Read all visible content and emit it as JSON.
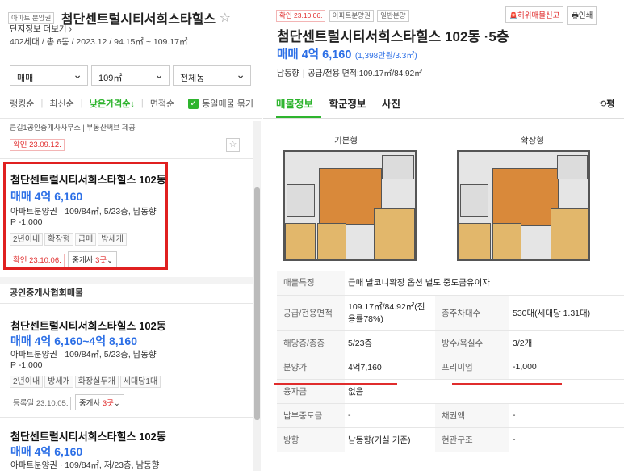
{
  "left_panel": {
    "header": {
      "type_tag": "아파트 분양권",
      "complex_name": "첨단센트럴시티서희스타힐스",
      "star": "☆",
      "info_link": "단지정보 더보기",
      "info_link_arrow": "›",
      "summary": "402세대 / 총 6동 / 2023.12 / 94.15㎡ ~ 109.17㎡"
    },
    "filters": [
      {
        "value": "매매",
        "chevron": "⌄"
      },
      {
        "value": "109㎡",
        "chevron": "⌄"
      },
      {
        "value": "전체동",
        "chevron": "⌄"
      }
    ],
    "sort": {
      "options": [
        "랭킹순",
        "최신순",
        "낮은가격순↓",
        "면적순"
      ],
      "separator": "|",
      "active": "낮은가격순↓",
      "checkbox_mark": "✓",
      "checkbox_label": "동일매물 묶기"
    },
    "partial_top": {
      "agency_text": "큰길1공인중개사사무소 | 부동산써브 제공",
      "confirm_tag": "확인 23.09.12."
    },
    "listings": [
      {
        "title": "첨단센트럴시티서희스타힐스 102동",
        "price": "매매 4억 6,160",
        "info": "아파트분양권 · 109/84㎡, 5/23층, 남동향",
        "premium": "P -1,000",
        "tags": [
          "2년이내",
          "확장형",
          "급매",
          "방세개"
        ],
        "confirm": "확인 23.10.06.",
        "agents_prefix": "중개사",
        "agents_count": "3곳",
        "agents_chevron": "⌄"
      },
      {
        "title": "첨단센트럴시티서희스타힐스 102동",
        "price": "매매 4억 6,160~4억 8,160",
        "info": "아파트분양권 · 109/84㎡, 5/23층, 남동향",
        "premium": "P -1,000",
        "tags": [
          "2년이내",
          "방세개",
          "화장실두개",
          "세대당1대"
        ],
        "confirm": "등록일 23.10.05.",
        "agents_prefix": "중개사",
        "agents_count": "3곳",
        "agents_chevron": "⌄"
      },
      {
        "title": "첨단센트럴시티서희스타힐스 102동",
        "price": "매매 4억 6,160",
        "info": "아파트분양권 · 109/84㎡, 저/23층, 남동향"
      }
    ],
    "section_header": "공인중개사협회매물"
  },
  "right_panel": {
    "tags": [
      "확인 23.10.06.",
      "아파트분양권",
      "일반분양"
    ],
    "buttons": {
      "report_icon": "🚨",
      "report": "허위매물신고",
      "print_icon": "🖶",
      "print": "인쇄"
    },
    "title": "첨단센트럴시티서희스타힐스 102동 ·5층",
    "price": "매매 4억 6,160",
    "price_per": "(1,398만원/3.3㎡)",
    "direction": "남동향",
    "area_label": "공급/전용 면적:",
    "area_value": "109.17㎡/84.92㎡",
    "tabs": [
      "매물정보",
      "학군정보",
      "사진"
    ],
    "active_tab": "매물정보",
    "side_icon": "⟲",
    "side_label": "평",
    "floorplans": [
      "기본형",
      "확장형"
    ],
    "table": [
      {
        "k1": "매물특징",
        "v1": "급매 발코니확장 옵션 별도 중도금유이자",
        "k2": "",
        "v2": ""
      },
      {
        "k1": "공급/전용면적",
        "v1": "109.17㎡/84.92㎡(전용률78%)",
        "k2": "총주차대수",
        "v2": "530대(세대당 1.31대)"
      },
      {
        "k1": "해당층/총층",
        "v1": "5/23층",
        "k2": "방수/욕실수",
        "v2": "3/2개"
      },
      {
        "k1": "분양가",
        "v1": "4억7,160",
        "k2": "프리미엄",
        "v2": "-1,000"
      },
      {
        "k1": "융자금",
        "v1": "없음",
        "k2": "",
        "v2": ""
      },
      {
        "k1": "납부중도금",
        "v1": "-",
        "k2": "채권액",
        "v2": "-"
      },
      {
        "k1": "방향",
        "v1": "남동향(거실 기준)",
        "k2": "현관구조",
        "v2": "-"
      }
    ]
  },
  "colors": {
    "accent_blue": "#2c6fe6",
    "highlight_red": "#e02c2c",
    "check_green": "#2eb42e"
  }
}
